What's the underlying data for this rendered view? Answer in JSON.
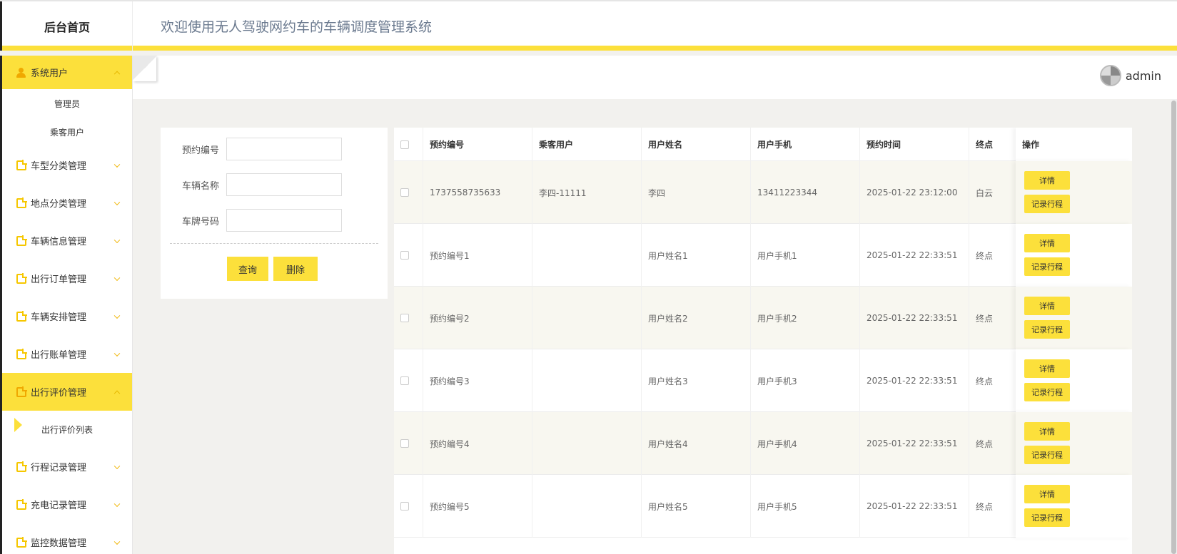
{
  "header": {
    "brand": "后台首页",
    "welcome": "欢迎使用无人驾驶网约车的车辆调度管理系统"
  },
  "user": {
    "name": "admin"
  },
  "sidebar": {
    "items": [
      {
        "label": "系统用户",
        "icon": "user-icon",
        "active": true,
        "expanded": true,
        "children": [
          "管理员",
          "乘客用户"
        ]
      },
      {
        "label": "车型分类管理",
        "icon": "doc-icon"
      },
      {
        "label": "地点分类管理",
        "icon": "doc-icon"
      },
      {
        "label": "车辆信息管理",
        "icon": "doc-icon"
      },
      {
        "label": "出行订单管理",
        "icon": "doc-icon"
      },
      {
        "label": "车辆安排管理",
        "icon": "doc-icon"
      },
      {
        "label": "出行账单管理",
        "icon": "doc-icon"
      },
      {
        "label": "出行评价管理",
        "icon": "doc-icon",
        "active": true,
        "expanded": true,
        "children": [
          "出行评价列表"
        ]
      },
      {
        "label": "行程记录管理",
        "icon": "doc-icon"
      },
      {
        "label": "充电记录管理",
        "icon": "doc-icon"
      },
      {
        "label": "监控数据管理",
        "icon": "doc-icon"
      }
    ]
  },
  "search": {
    "fields": [
      {
        "label": "预约编号",
        "value": ""
      },
      {
        "label": "车辆名称",
        "value": ""
      },
      {
        "label": "车牌号码",
        "value": ""
      }
    ],
    "query_label": "查询",
    "delete_label": "删除"
  },
  "table": {
    "columns": [
      "预约编号",
      "乘客用户",
      "用户姓名",
      "用户手机",
      "预约时间",
      "终点",
      "操作"
    ],
    "rows": [
      [
        "1737558735633",
        "李四-11111",
        "李四",
        "13411223344",
        "2025-01-22 23:12:00",
        "白云"
      ],
      [
        "预约编号1",
        "",
        "用户姓名1",
        "用户手机1",
        "2025-01-22 22:33:51",
        "终点"
      ],
      [
        "预约编号2",
        "",
        "用户姓名2",
        "用户手机2",
        "2025-01-22 22:33:51",
        "终点"
      ],
      [
        "预约编号3",
        "",
        "用户姓名3",
        "用户手机3",
        "2025-01-22 22:33:51",
        "终点"
      ],
      [
        "预约编号4",
        "",
        "用户姓名4",
        "用户手机4",
        "2025-01-22 22:33:51",
        "终点"
      ],
      [
        "预约编号5",
        "",
        "用户姓名5",
        "用户手机5",
        "2025-01-22 22:33:51",
        "终点"
      ]
    ],
    "detail_label": "详情",
    "trip_label": "记录行程"
  },
  "colors": {
    "accent": "#fce03b",
    "icon": "#f0a800"
  }
}
